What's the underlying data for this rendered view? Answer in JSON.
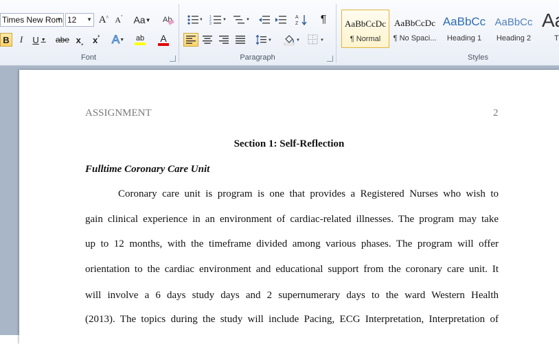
{
  "ribbon": {
    "font": {
      "font_name": "Times New Rom",
      "font_size": "12",
      "label": "Font",
      "grow_label": "A",
      "shrink_label": "A",
      "case_label": "Aa",
      "bold": "B",
      "italic": "I",
      "underline": "U",
      "strike": "abe",
      "subscript": "x",
      "superscript": "x",
      "effects_glyph": "A",
      "highlight_glyph": "ab",
      "color_glyph": "A",
      "highlight_color": "#ffff00",
      "font_color": "#e00000"
    },
    "paragraph": {
      "label": "Paragraph",
      "pilcrow": "¶"
    },
    "styles": {
      "label": "Styles",
      "items": [
        {
          "sample": "AaBbCcDc",
          "name": "¶ Normal",
          "color": "#111111"
        },
        {
          "sample": "AaBbCcDc",
          "name": "¶ No Spaci...",
          "color": "#111111"
        },
        {
          "sample": "AaBbCc",
          "name": "Heading 1",
          "color": "#2e6db5"
        },
        {
          "sample": "AaBbCc",
          "name": "Heading 2",
          "color": "#4f81bd"
        },
        {
          "sample": "Aa",
          "name": "T",
          "color": "#333333"
        }
      ]
    }
  },
  "document": {
    "header_left": "ASSIGNMENT",
    "header_right": "2",
    "section_title": "Section 1: Self-Reflection",
    "subheading": "Fulltime Coronary Care Unit",
    "lines": [
      "Coronary care unit is program is one that provides a Registered Nurses who wish to",
      "gain clinical experience in an environment of cardiac-related illnesses. The program may take",
      "up to 12 months, with the timeframe divided among various phases. The program will offer",
      "orientation to the cardiac environment and educational support from the coronary care unit. It",
      "will involve a 6 days study days and 2 supernumerary days to the ward Western Health",
      "(2013). The topics during the study will include Pacing, ECG Interpretation, Interpretation of"
    ]
  }
}
